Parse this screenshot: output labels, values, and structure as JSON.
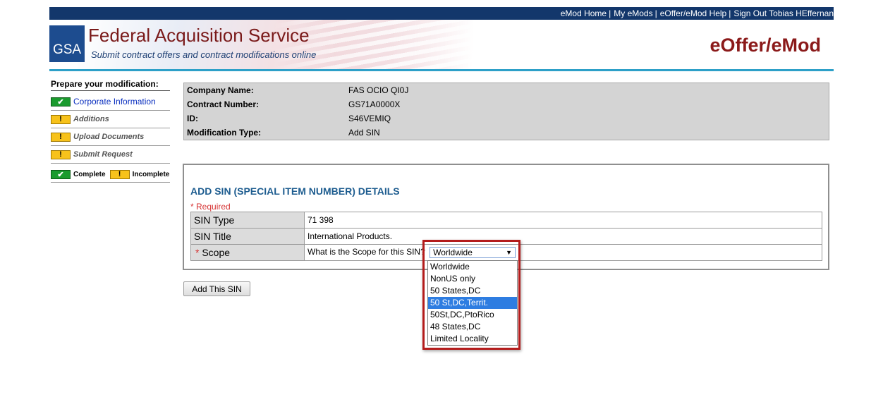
{
  "topnav": {
    "items": [
      "eMod Home",
      "My eMods",
      "eOffer/eMod Help",
      "Sign Out Tobias HEffernan"
    ],
    "separator": "|"
  },
  "header": {
    "logo_text": "GSA",
    "title": "Federal Acquisition Service",
    "subtitle": "Submit contract offers and contract modifications online",
    "brand": "eOffer/eMod"
  },
  "sidebar": {
    "heading": "Prepare your modification:",
    "items": [
      {
        "label": "Corporate Information",
        "status": "complete"
      },
      {
        "label": "Additions",
        "status": "incomplete"
      },
      {
        "label": "Upload Documents",
        "status": "incomplete"
      },
      {
        "label": "Submit Request",
        "status": "incomplete"
      }
    ],
    "legend": {
      "complete": "Complete",
      "incomplete": "Incomplete"
    }
  },
  "info": {
    "rows": [
      {
        "label": "Company Name:",
        "value": "FAS OCIO QI0J"
      },
      {
        "label": "Contract Number:",
        "value": "GS71A0000X"
      },
      {
        "label": "ID:",
        "value": "S46VEMIQ"
      },
      {
        "label": "Modification Type:",
        "value": "Add SIN"
      }
    ]
  },
  "details": {
    "title": "ADD SIN (SPECIAL ITEM NUMBER) DETAILS",
    "required_note": "* Required",
    "rows": {
      "sin_type": {
        "label": "SIN Type",
        "value": "71 398"
      },
      "sin_title": {
        "label": "SIN Title",
        "value": "International Products."
      },
      "scope": {
        "star": "*",
        "label": "Scope",
        "question": "What is the Scope for this SIN?"
      }
    },
    "scope_select": {
      "selected": "Worldwide",
      "highlighted": "50 St,DC,Territ.",
      "options": [
        "Worldwide",
        "NonUS only",
        "50 States,DC",
        "50 St,DC,Territ.",
        "50St,DC,PtoRico",
        "48 States,DC",
        "Limited Locality"
      ]
    }
  },
  "actions": {
    "add_button": "Add This SIN"
  },
  "icons": {
    "check": "check-icon",
    "warn": "exclamation-icon",
    "arrow": "chevron-down-icon"
  },
  "colors": {
    "nav_bg": "#13376b",
    "accent_rule": "#2da0c8",
    "brand_red": "#8b1a1a",
    "highlight_red": "#b41c1c",
    "required_red": "#d63232"
  }
}
